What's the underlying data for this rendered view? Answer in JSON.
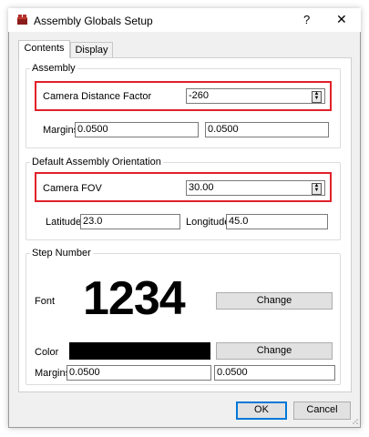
{
  "window": {
    "title": "Assembly Globals Setup",
    "help_glyph": "?",
    "close_glyph": "✕",
    "app_icon": "lego-brick-icon"
  },
  "tabs": [
    {
      "label": "Contents"
    },
    {
      "label": "Display"
    }
  ],
  "assembly": {
    "legend": "Assembly",
    "camera_distance_label": "Camera Distance Factor",
    "camera_distance_value": "-260",
    "margins_label": "Margins",
    "margin_left": "0.0500",
    "margin_right": "0.0500"
  },
  "orientation": {
    "legend": "Default Assembly Orientation",
    "camera_fov_label": "Camera FOV",
    "camera_fov_value": "30.00",
    "latitude_label": "Latitude",
    "latitude_value": "23.0",
    "longitude_label": "Longitude",
    "longitude_value": "45.0"
  },
  "step_number": {
    "legend": "Step Number",
    "font_label": "Font",
    "font_sample": "1234",
    "font_change": "Change",
    "color_label": "Color",
    "color_swatch": "#000000",
    "color_change": "Change",
    "margins_label": "Margins",
    "margin_left": "0.0500",
    "margin_right": "0.0500"
  },
  "buttons": {
    "ok": "OK",
    "cancel": "Cancel"
  },
  "colors": {
    "highlight": "#e0202a",
    "accent": "#0078d7"
  }
}
